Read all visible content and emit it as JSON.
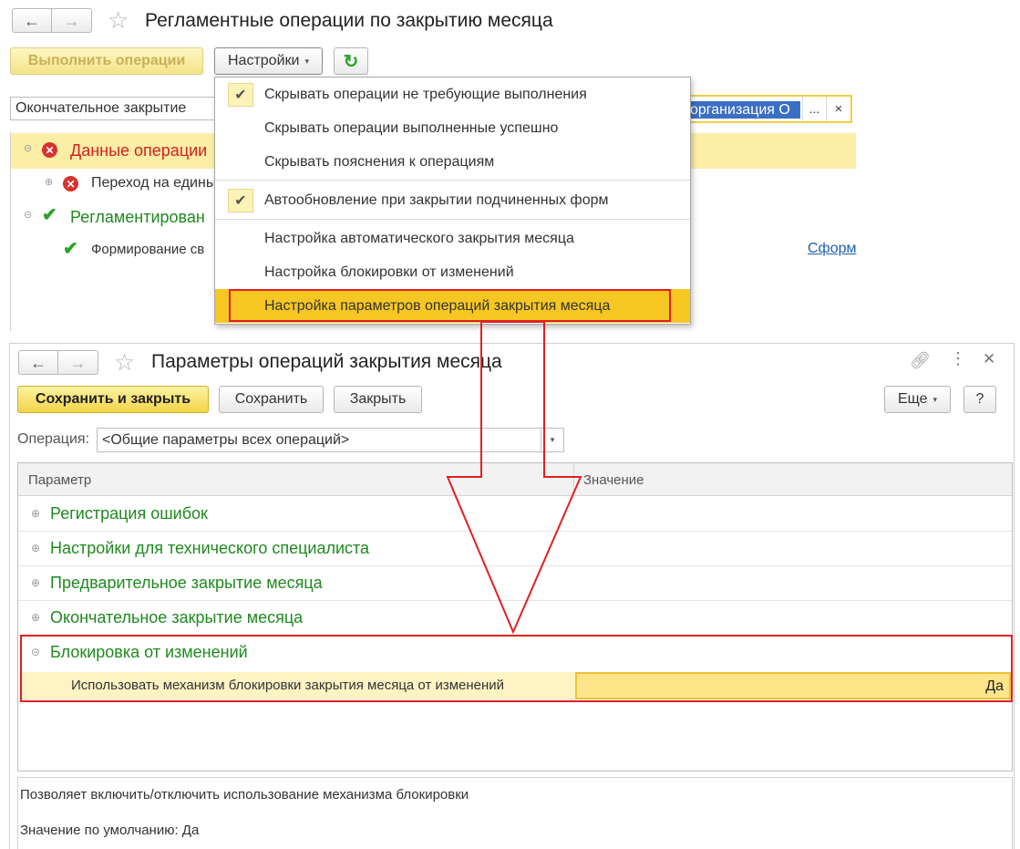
{
  "bg": {
    "title": "Регламентные операции по закрытию месяца",
    "run_button": "Выполнить операции",
    "settings_button": "Настройки",
    "mode_field": "Окончательное закрытие",
    "org_field": "организация О",
    "org_more": "...",
    "org_clear": "×",
    "tree": [
      {
        "label": "Данные операции"
      },
      {
        "label": "Переход на едины"
      },
      {
        "label": "Регламентирован"
      },
      {
        "label": "Формирование св"
      }
    ],
    "link": "Сформ"
  },
  "menu": {
    "items": [
      {
        "label": "Скрывать операции не требующие выполнения",
        "checked": true
      },
      {
        "label": "Скрывать операции выполненные успешно",
        "checked": false
      },
      {
        "label": "Скрывать пояснения к операциям",
        "checked": false
      },
      {
        "label": "Автообновление при закрытии подчиненных форм",
        "checked": true
      },
      {
        "label": "Настройка автоматического закрытия месяца",
        "checked": false
      },
      {
        "label": "Настройка блокировки от изменений",
        "checked": false
      },
      {
        "label": "Настройка параметров операций закрытия месяца",
        "checked": false,
        "highlighted": true
      }
    ]
  },
  "win2": {
    "title": "Параметры операций закрытия месяца",
    "save_close": "Сохранить и закрыть",
    "save": "Сохранить",
    "close": "Закрыть",
    "more": "Еще",
    "help": "?",
    "operation_label": "Операция:",
    "operation_value": "<Общие параметры всех операций>",
    "columns": {
      "param": "Параметр",
      "value": "Значение"
    },
    "groups": [
      {
        "label": "Регистрация ошибок"
      },
      {
        "label": "Настройки для технического специалиста"
      },
      {
        "label": "Предварительное закрытие месяца"
      },
      {
        "label": "Окончательное закрытие месяца"
      },
      {
        "label": "Блокировка от изменений"
      }
    ],
    "row": {
      "param": "Использовать механизм блокировки закрытия месяца от изменений",
      "value": "Да"
    },
    "description": "Позволяет включить/отключить использование механизма блокировки",
    "default_value": "Значение по умолчанию: Да"
  },
  "colors": {
    "accent_yellow": "#f3d44a",
    "highlight_red": "#e02020",
    "group_green": "#1e8a1e"
  }
}
